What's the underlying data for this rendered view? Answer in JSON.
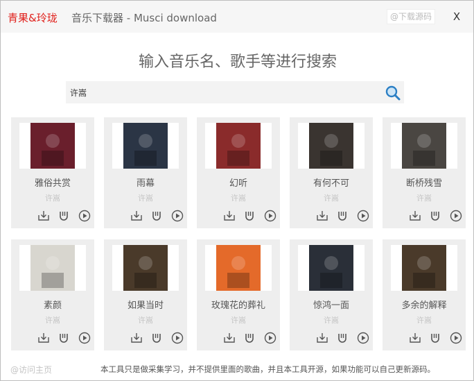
{
  "titlebar": {
    "brand": "青果&玲珑",
    "app_title": "音乐下载器 - Musci download",
    "download_source": "@下载源码",
    "close": "X"
  },
  "main": {
    "heading": "输入音乐名、歌手等进行搜索",
    "search": {
      "value": "许嵩",
      "placeholder": ""
    }
  },
  "results": [
    {
      "title": "雅俗共赏",
      "artist": "许嵩",
      "cover_color": "#6a1f2c"
    },
    {
      "title": "雨幕",
      "artist": "许嵩",
      "cover_color": "#2b3545"
    },
    {
      "title": "幻听",
      "artist": "许嵩",
      "cover_color": "#8a2b2b"
    },
    {
      "title": "有何不可",
      "artist": "许嵩",
      "cover_color": "#3a3430"
    },
    {
      "title": "断桥残雪",
      "artist": "许嵩",
      "cover_color": "#4a4642"
    },
    {
      "title": "素颜",
      "artist": "许嵩",
      "cover_color": "#d8d6cf"
    },
    {
      "title": "如果当时",
      "artist": "许嵩",
      "cover_color": "#4a3a2a"
    },
    {
      "title": "玫瑰花的葬礼",
      "artist": "许嵩",
      "cover_color": "#e46a2a"
    },
    {
      "title": "惊鸿一面",
      "artist": "许嵩",
      "cover_color": "#2a2f38"
    },
    {
      "title": "多余的解释",
      "artist": "许嵩",
      "cover_color": "#4a3a2a"
    }
  ],
  "footer": {
    "visit_home": "@访问主页",
    "note": "本工具只是做采集学习，并不提供里面的歌曲，并且本工具开源，如果功能可以自己更新源码。"
  }
}
